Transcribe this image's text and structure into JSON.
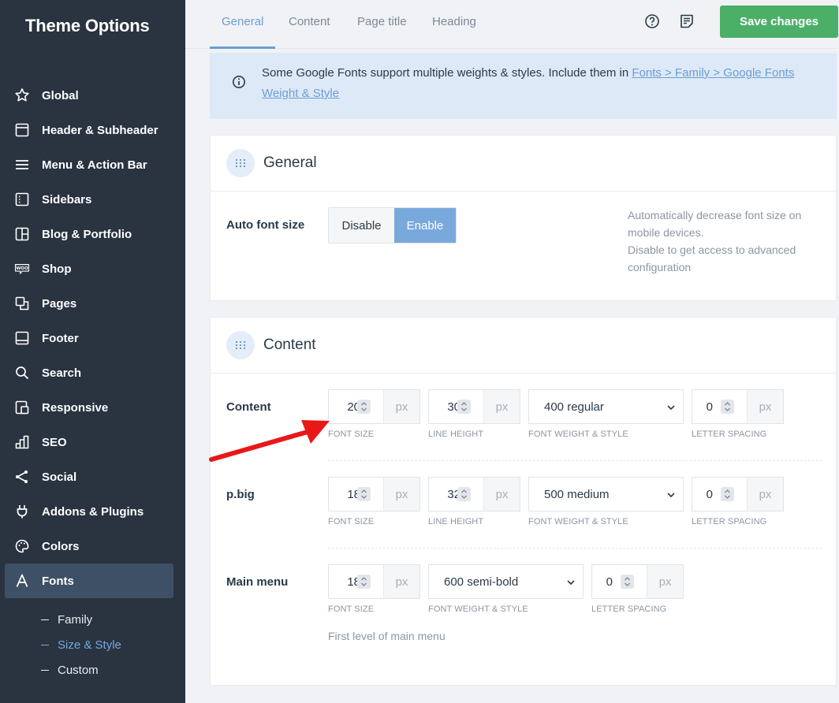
{
  "sidebar": {
    "title": "Theme Options",
    "items": [
      {
        "label": "Global",
        "icon": "star-icon"
      },
      {
        "label": "Header & Subheader",
        "icon": "header-icon"
      },
      {
        "label": "Menu & Action Bar",
        "icon": "menu-icon"
      },
      {
        "label": "Sidebars",
        "icon": "sidebar-icon"
      },
      {
        "label": "Blog & Portfolio",
        "icon": "grid-icon"
      },
      {
        "label": "Shop",
        "icon": "woo-icon"
      },
      {
        "label": "Pages",
        "icon": "pages-icon"
      },
      {
        "label": "Footer",
        "icon": "footer-icon"
      },
      {
        "label": "Search",
        "icon": "search-icon"
      },
      {
        "label": "Responsive",
        "icon": "responsive-icon"
      },
      {
        "label": "SEO",
        "icon": "seo-icon"
      },
      {
        "label": "Social",
        "icon": "share-icon"
      },
      {
        "label": "Addons & Plugins",
        "icon": "plug-icon"
      },
      {
        "label": "Colors",
        "icon": "palette-icon"
      },
      {
        "label": "Fonts",
        "icon": "font-icon",
        "active": true
      }
    ],
    "subitems": [
      {
        "label": "Family"
      },
      {
        "label": "Size & Style",
        "active": true
      },
      {
        "label": "Custom"
      }
    ]
  },
  "topbar": {
    "tabs": [
      "General",
      "Content",
      "Page title",
      "Heading"
    ],
    "active_tab": "General",
    "save_label": "Save changes"
  },
  "info": {
    "text": "Some Google Fonts support multiple weights & styles. Include them in",
    "link": "Fonts > Family > Google Fonts Weight & Style"
  },
  "general_card": {
    "title": "General",
    "auto_font_size": {
      "label": "Auto font size",
      "options": [
        "Disable",
        "Enable"
      ],
      "selected": "Enable",
      "description_1": "Automatically decrease font size on mobile devices.",
      "description_2": "Disable to get access to advanced configuration"
    }
  },
  "content_card": {
    "title": "Content",
    "unit": "px",
    "captions": {
      "font_size": "FONT SIZE",
      "line_height": "LINE HEIGHT",
      "font_weight": "FONT WEIGHT & STYLE",
      "letter_spacing": "LETTER SPACING"
    },
    "rows": [
      {
        "label": "Content",
        "font_size": "20",
        "line_height": "30",
        "weight": "400 regular",
        "letter_spacing": "0"
      },
      {
        "label": "p.big",
        "font_size": "18",
        "line_height": "32",
        "weight": "500 medium",
        "letter_spacing": "0"
      },
      {
        "label": "Main menu",
        "font_size": "18",
        "weight": "600 semi-bold",
        "letter_spacing": "0",
        "note": "First level of main menu"
      }
    ]
  },
  "colors": {
    "sidebar_bg": "#2a3340",
    "active_nav": "#3d5066",
    "accent_blue": "#6c9ed3",
    "save_green": "#4caf68",
    "annotation_arrow": "#e81818"
  }
}
